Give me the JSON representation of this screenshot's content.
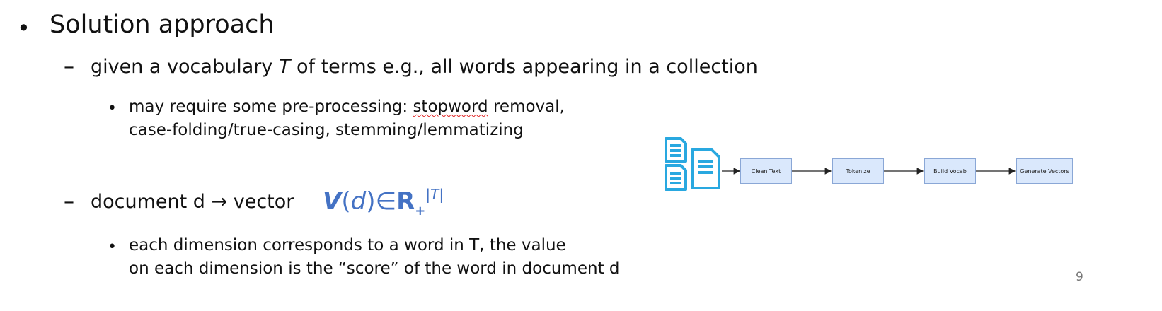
{
  "bullets": {
    "level1": {
      "marker": "•",
      "text": "Solution approach"
    },
    "item1": {
      "marker": "–",
      "text_before": "given a vocabulary ",
      "var": "T",
      "text_after": " of terms e.g., all words appearing in a collection",
      "sub": {
        "marker": "•",
        "line1_before": "may require some pre-processing: ",
        "line1_wavy": "stopword",
        "line1_after": " removal,",
        "line2": "case-folding/true-casing, stemming/lemmatizing"
      }
    },
    "item2": {
      "marker": "–",
      "text_before": "document d ",
      "arrow": "→",
      "text_after": " vector",
      "math": {
        "V": "V",
        "open": "(",
        "d": "d",
        "close": ")",
        "in": "∈",
        "R": "R",
        "sub": "+",
        "sup": "|T|"
      },
      "sub": {
        "marker": "•",
        "line1": "each dimension corresponds to a word in T, the value",
        "line2": "on each dimension is the “score” of the word in document d"
      }
    }
  },
  "diagram": {
    "steps": [
      "Clean Text",
      "Tokenize",
      "Build Vocab",
      "Generate Vectors"
    ],
    "colors": {
      "doc_icon": "#29a8e0",
      "box_fill": "#dae8fc",
      "box_border": "#8aa7d6",
      "arrow": "#222222"
    }
  },
  "page_number": "9",
  "colors": {
    "math": "#4472c4",
    "text": "#111111",
    "page_number": "#777777"
  }
}
